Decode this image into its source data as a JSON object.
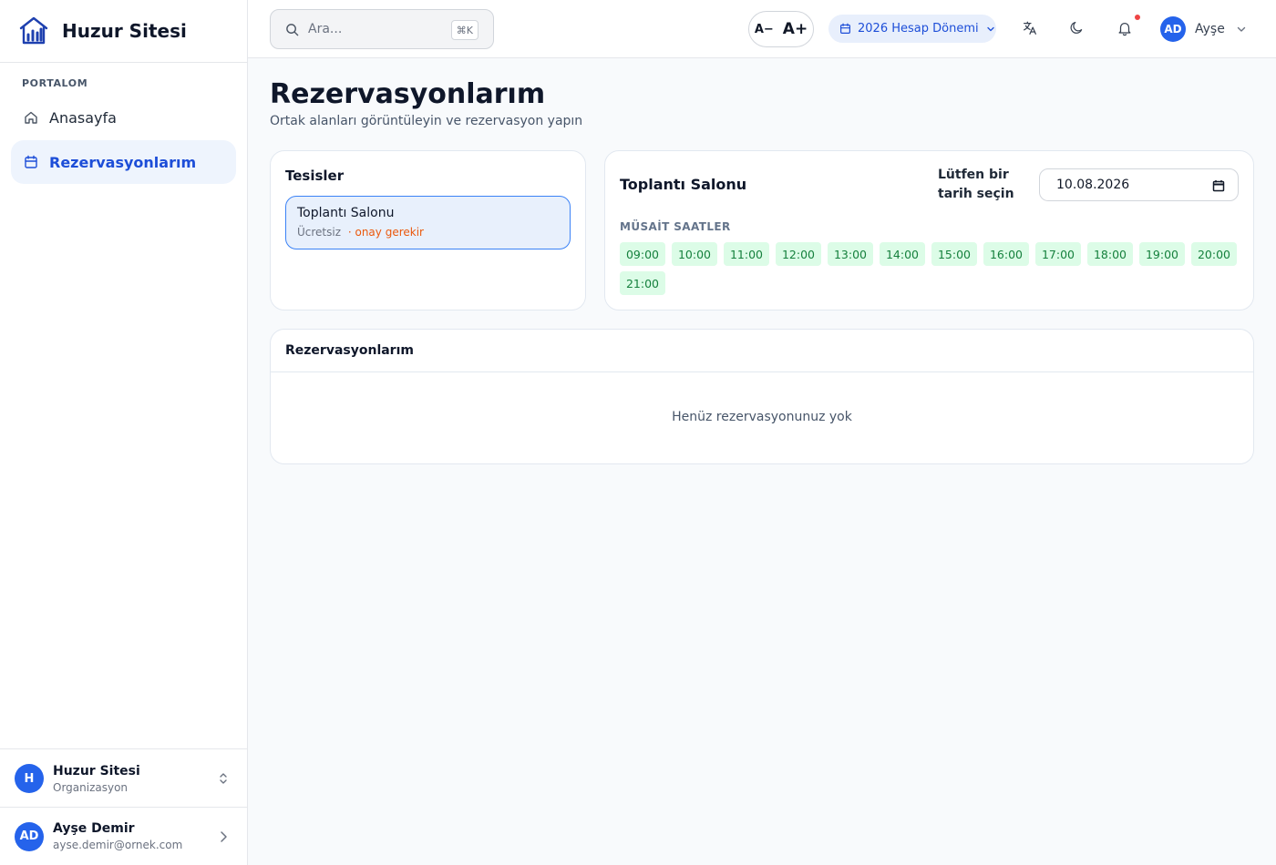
{
  "brand": {
    "name": "Huzur Sitesi",
    "icon": "building-chart-icon"
  },
  "sidebar": {
    "section": "PORTALOM",
    "items": [
      {
        "label": "Anasayfa",
        "icon": "home-icon",
        "active": false
      },
      {
        "label": "Rezervasyonlarım",
        "icon": "calendar-icon",
        "active": true
      }
    ],
    "org": {
      "avatar": "H",
      "name": "Huzur Sitesi",
      "type": "Organizasyon"
    },
    "user": {
      "avatar": "AD",
      "name": "Ayşe Demir",
      "email": "ayse.demir@ornek.com"
    }
  },
  "topbar": {
    "search_placeholder": "Ara...",
    "search_shortcut": "⌘K",
    "font_decrease": "A−",
    "font_increase": "A+",
    "period": "2026 Hesap Dönemi",
    "user_avatar": "AD",
    "user_name": "Ayşe",
    "has_notification": true
  },
  "page": {
    "title": "Rezervasyonlarım",
    "subtitle": "Ortak alanları görüntüleyin ve rezervasyon yapın"
  },
  "facilities": {
    "title": "Tesisler",
    "items": [
      {
        "name": "Toplantı Salonu",
        "price": "Ücretsiz",
        "approval": "· onay gerekir",
        "selected": true
      }
    ]
  },
  "slots": {
    "title": "Toplantı Salonu",
    "date_label": "Lütfen bir tarih seçin",
    "date_value": "10.08.2026",
    "available_label": "MÜSAİT SAATLER",
    "times": [
      "09:00",
      "10:00",
      "11:00",
      "12:00",
      "13:00",
      "14:00",
      "15:00",
      "16:00",
      "17:00",
      "18:00",
      "19:00",
      "20:00",
      "21:00"
    ]
  },
  "reservations": {
    "title": "Rezervasyonlarım",
    "empty": "Henüz rezervasyonunuz yok"
  },
  "colors": {
    "primary": "#2563eb",
    "active_bg": "#eef4fd",
    "slot_bg": "#dcfce7",
    "slot_text": "#15803d",
    "warning": "#ea580c",
    "notification": "#ef4444"
  }
}
